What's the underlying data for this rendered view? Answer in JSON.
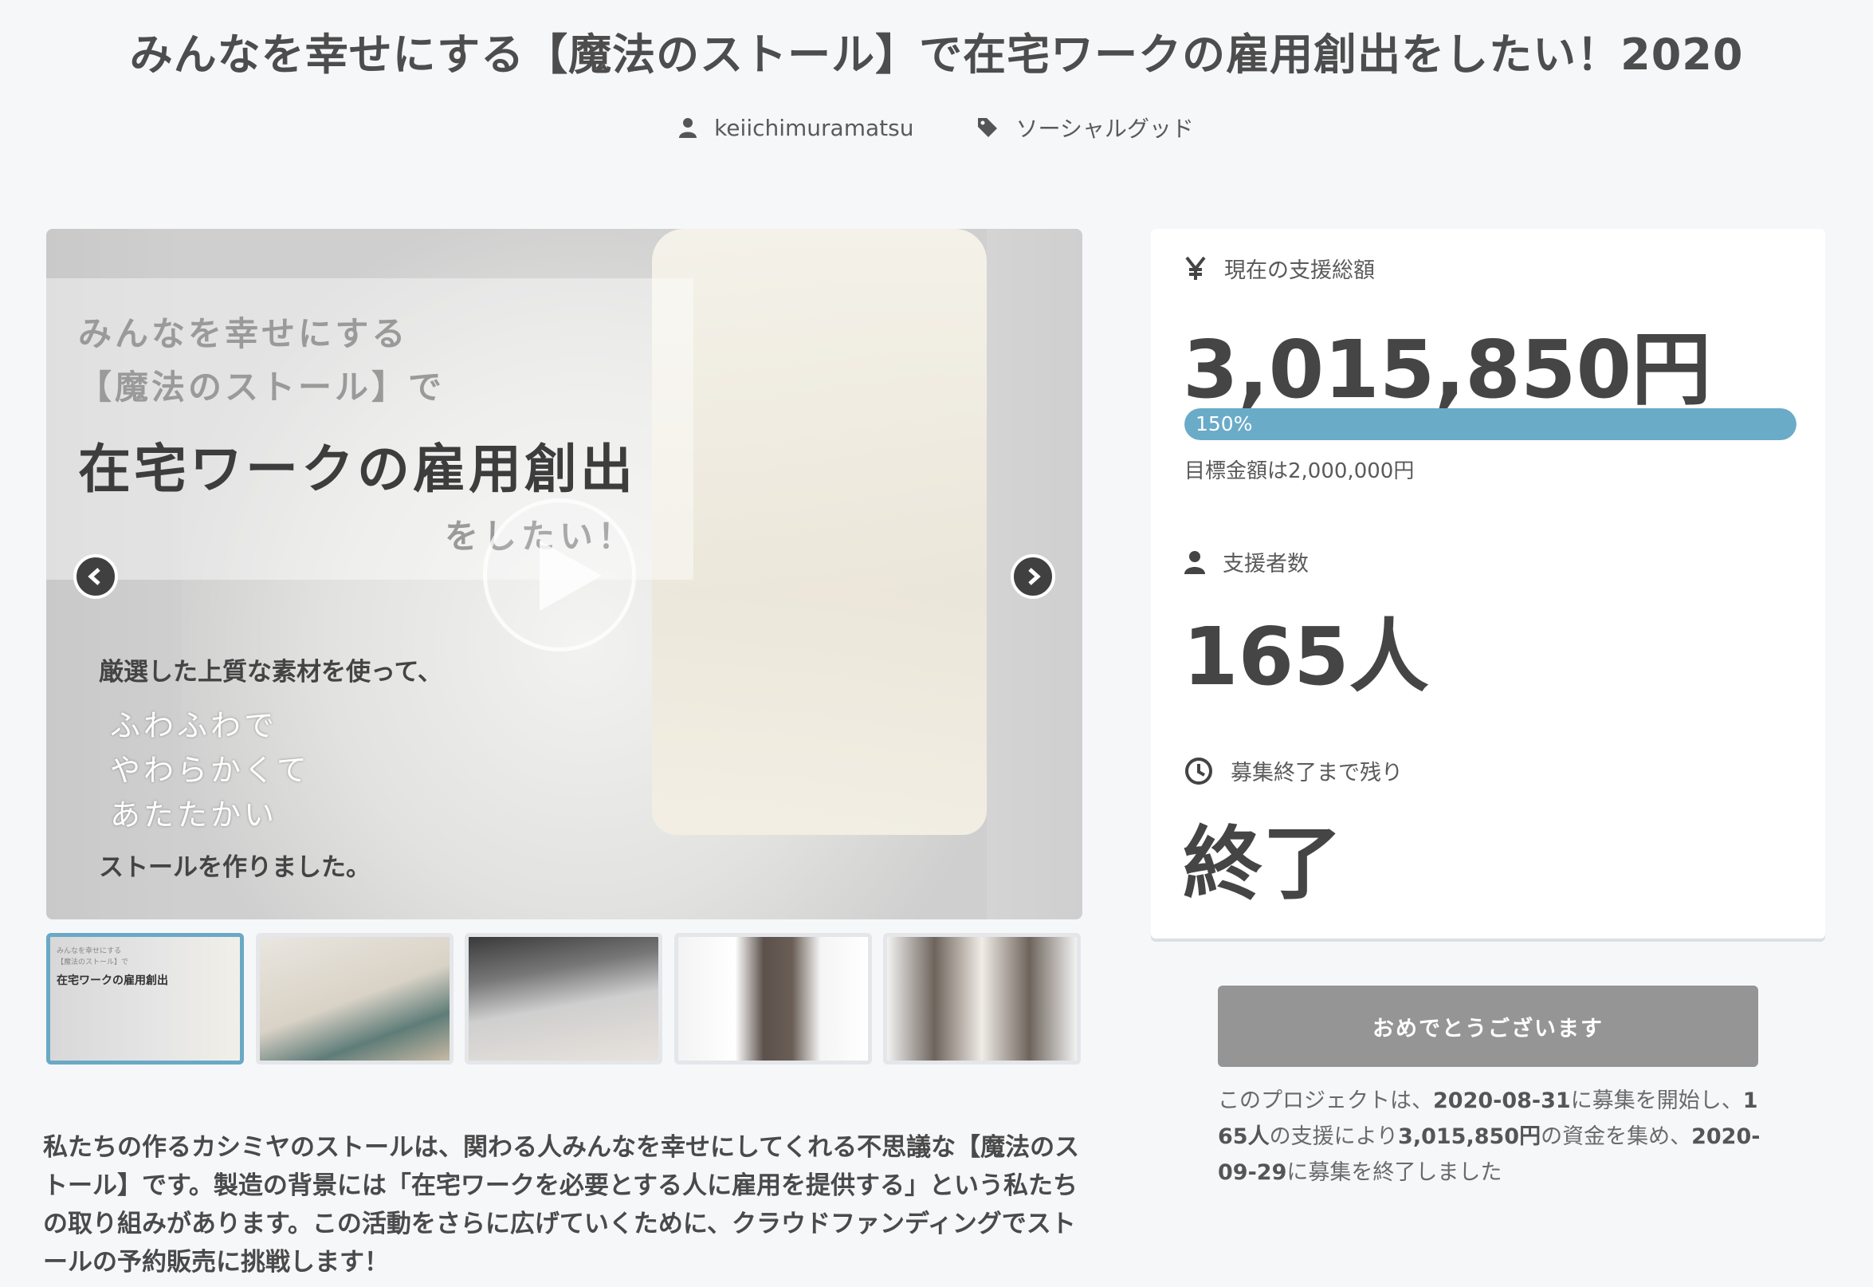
{
  "page": {
    "title": "みんなを幸せにする【魔法のストール】で在宅ワークの雇用創出をしたい！2020",
    "author": "keiichimuramatsu",
    "category": "ソーシャルグッド"
  },
  "hero": {
    "overlay_line1": "みんなを幸せにする",
    "overlay_line2": "【魔法のストール】で",
    "overlay_line3": "在宅ワークの雇用創出",
    "overlay_line4": "をしたい！",
    "text_line1": "厳選した上質な素材を使って、",
    "text_line2": "ふわふわで",
    "text_line3": "やわらかくて",
    "text_line4": "あたたかい",
    "text_line5": "ストールを作りました。"
  },
  "thumbnail_text": {
    "line1": "みんなを幸せにする",
    "line2": "【魔法のストール】で",
    "line3": "在宅ワークの雇用創出"
  },
  "description": "私たちの作るカシミヤのストールは、関わる人みんなを幸せにしてくれる不思議な【魔法のストール】です。製造の背景には「在宅ワークを必要とする人に雇用を提供する」という私たちの取り組みがあります。この活動をさらに広げていくために、クラウドファンディングでストールの予約販売に挑戦します！",
  "stats": {
    "funding_label": "現在の支援総額",
    "funding_amount": "3,015,850円",
    "progress_label": "150%",
    "progress_fraction": 1.0,
    "goal_text": "目標金額は2,000,000円",
    "backers_label": "支援者数",
    "backers_count": "165人",
    "remaining_label": "募集終了まで残り",
    "remaining_value": "終了"
  },
  "cta": {
    "button_label": "おめでとうございます"
  },
  "summary": {
    "p1": "このプロジェクトは、",
    "start_date": "2020-08-31",
    "p2": "に募集を開始し、",
    "backers": "165人",
    "p3": "の支援により",
    "amount": "3,015,850円",
    "p4": "の資金を集め、",
    "end_date": "2020-09-29",
    "p5": "に募集を終了しました"
  },
  "colors": {
    "accent": "#6aabc8",
    "button": "#959595",
    "background": "#f6f7f9"
  },
  "icons": [
    "user-icon",
    "tag-icon",
    "yen-icon",
    "clock-icon",
    "play-icon",
    "chevron-left-icon",
    "chevron-right-icon"
  ]
}
